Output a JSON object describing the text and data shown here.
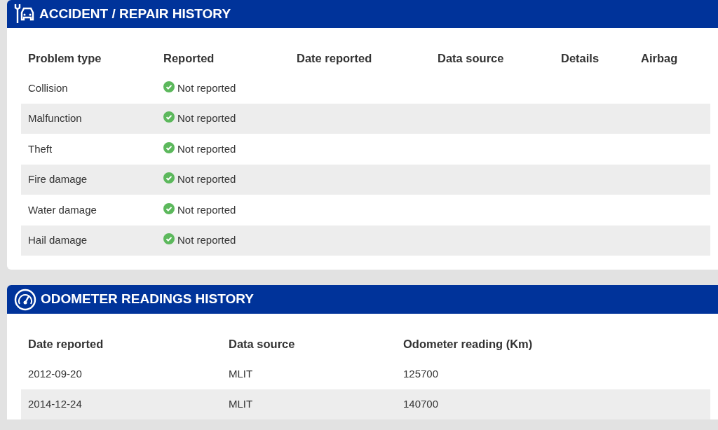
{
  "accident_history": {
    "title": "ACCIDENT / REPAIR HISTORY",
    "columns": [
      "Problem type",
      "Reported",
      "Date reported",
      "Data source",
      "Details",
      "Airbag"
    ],
    "rows": [
      {
        "problem_type": "Collision",
        "reported": false,
        "status": "Not reported"
      },
      {
        "problem_type": "Malfunction",
        "reported": false,
        "status": "Not reported"
      },
      {
        "problem_type": "Theft",
        "reported": false,
        "status": "Not reported"
      },
      {
        "problem_type": "Fire damage",
        "reported": false,
        "status": "Not reported"
      },
      {
        "problem_type": "Water damage",
        "reported": false,
        "status": "Not reported"
      },
      {
        "problem_type": "Hail damage",
        "reported": false,
        "status": "Not reported"
      }
    ]
  },
  "odometer_history": {
    "title": "ODOMETER READINGS HISTORY",
    "columns": [
      "Date reported",
      "Data source",
      "Odometer reading (Km)"
    ],
    "rows": [
      [
        "2012-09-20",
        "MLIT",
        "125700"
      ],
      [
        "2014-12-24",
        "MLIT",
        "140700"
      ]
    ]
  }
}
